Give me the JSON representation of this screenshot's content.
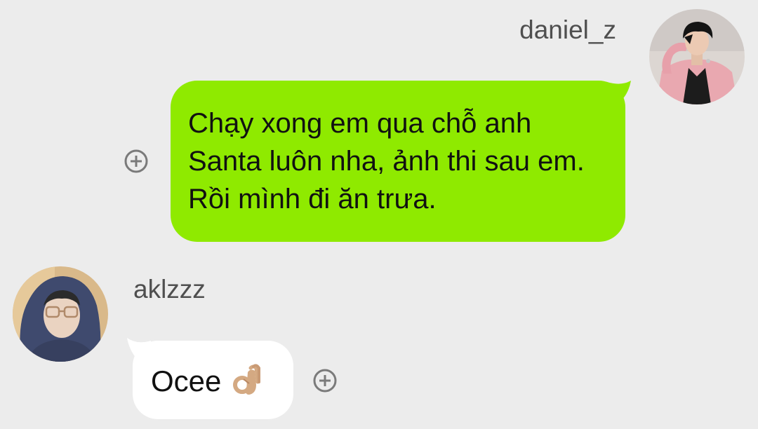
{
  "messages": [
    {
      "sender": "daniel_z",
      "text": "Chạy xong em qua chỗ anh Santa luôn nha, ảnh thi sau em. Rồi mình đi ăn trưa.",
      "bubble_color": "#8fea00",
      "avatar_icon": "user-avatar-daniel-icon"
    },
    {
      "sender": "aklzzz",
      "text": "Ocee",
      "emoji_icon": "ok-hand-emoji-icon",
      "bubble_color": "#ffffff",
      "avatar_icon": "user-avatar-aklzzz-icon"
    }
  ],
  "colors": {
    "background": "#ececec",
    "name_text": "#4f4f4f",
    "add_reaction": "#7a7a7a"
  }
}
